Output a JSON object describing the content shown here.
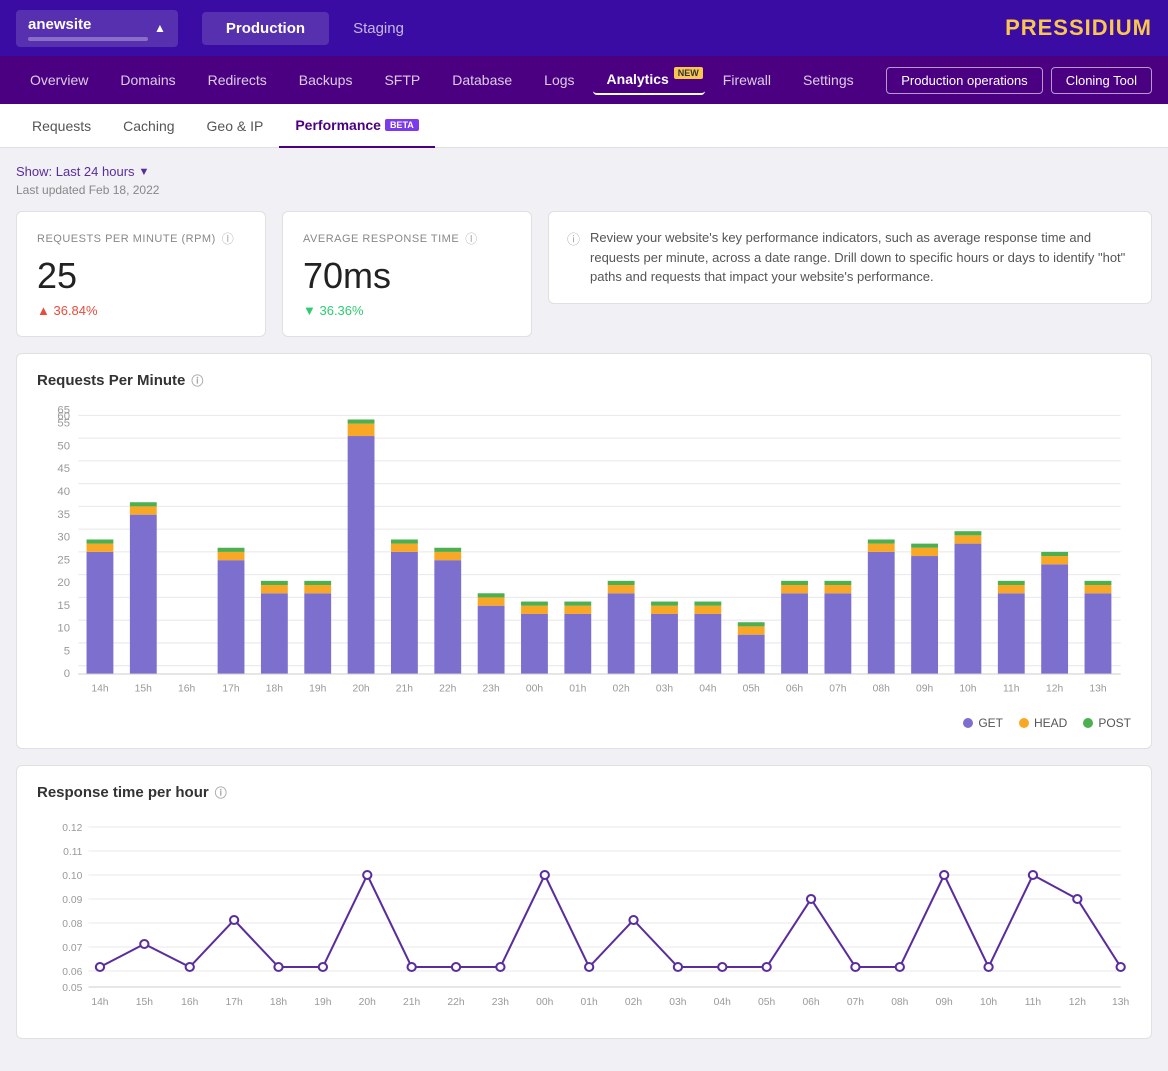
{
  "site": {
    "name": "anewsite",
    "arrow": "▲"
  },
  "env_tabs": [
    {
      "label": "Production",
      "active": true
    },
    {
      "label": "Staging",
      "active": false
    }
  ],
  "logo": {
    "text1": "PRESS",
    "text2": "I",
    "text3": "DIUM"
  },
  "nav": {
    "items": [
      {
        "label": "Overview",
        "active": false,
        "badge": null
      },
      {
        "label": "Domains",
        "active": false,
        "badge": null
      },
      {
        "label": "Redirects",
        "active": false,
        "badge": null
      },
      {
        "label": "Backups",
        "active": false,
        "badge": null
      },
      {
        "label": "SFTP",
        "active": false,
        "badge": null
      },
      {
        "label": "Database",
        "active": false,
        "badge": null
      },
      {
        "label": "Logs",
        "active": false,
        "badge": null
      },
      {
        "label": "Analytics",
        "active": true,
        "badge": "NEW"
      },
      {
        "label": "Firewall",
        "active": false,
        "badge": null
      },
      {
        "label": "Settings",
        "active": false,
        "badge": null
      }
    ],
    "actions": [
      {
        "label": "Production operations"
      },
      {
        "label": "Cloning Tool"
      }
    ]
  },
  "subnav": {
    "items": [
      {
        "label": "Requests",
        "active": false,
        "beta": false
      },
      {
        "label": "Caching",
        "active": false,
        "beta": false
      },
      {
        "label": "Geo & IP",
        "active": false,
        "beta": false
      },
      {
        "label": "Performance",
        "active": true,
        "beta": true
      }
    ]
  },
  "date_filter": {
    "label": "Show: Last 24 hours",
    "last_updated": "Last updated Feb 18, 2022"
  },
  "kpi": {
    "rpm": {
      "label": "REQUESTS PER MINUTE (RPM)",
      "value": "25",
      "change": "▲ 36.84%",
      "change_type": "up"
    },
    "art": {
      "label": "AVERAGE RESPONSE TIME",
      "value": "70ms",
      "change": "▼ 36.36%",
      "change_type": "down"
    },
    "description": "Review your website's key performance indicators, such as average response time and requests per minute, across a date range. Drill down to specific hours or days to identify \"hot\" paths and requests that impact your website's performance."
  },
  "rpm_chart": {
    "title": "Requests Per Minute",
    "labels": [
      "14h",
      "15h",
      "16h",
      "17h",
      "18h",
      "19h",
      "20h",
      "21h",
      "22h",
      "23h",
      "00h",
      "01h",
      "02h",
      "03h",
      "04h",
      "05h",
      "06h",
      "07h",
      "08h",
      "09h",
      "10h",
      "11h",
      "12h",
      "13h"
    ],
    "get_values": [
      30,
      39,
      0,
      28,
      20,
      20,
      59,
      30,
      28,
      17,
      15,
      15,
      20,
      15,
      15,
      10,
      20,
      20,
      30,
      29,
      32,
      20,
      27,
      20
    ],
    "head_values": [
      2,
      2,
      0,
      2,
      1,
      1,
      3,
      1,
      2,
      1,
      1,
      1,
      1,
      1,
      1,
      1,
      1,
      1,
      2,
      2,
      2,
      1,
      2,
      1
    ],
    "post_values": [
      1,
      1,
      0,
      1,
      1,
      1,
      2,
      1,
      1,
      1,
      1,
      1,
      1,
      1,
      1,
      1,
      1,
      1,
      1,
      1,
      1,
      1,
      1,
      1
    ],
    "y_max": 65,
    "y_ticks": [
      0,
      5,
      10,
      15,
      20,
      25,
      30,
      35,
      40,
      45,
      50,
      55,
      60,
      65
    ],
    "legend": {
      "get": "GET",
      "head": "HEAD",
      "post": "POST",
      "get_color": "#7c6fcd",
      "head_color": "#f9a825",
      "post_color": "#4caf50"
    }
  },
  "response_chart": {
    "title": "Response time per hour",
    "labels": [
      "14h",
      "15h",
      "16h",
      "17h",
      "18h",
      "19h",
      "20h",
      "21h",
      "22h",
      "23h",
      "00h",
      "01h",
      "02h",
      "03h",
      "04h",
      "05h",
      "06h",
      "07h",
      "08h",
      "09h",
      "10h",
      "11h",
      "12h",
      "13h"
    ],
    "values": [
      0.06,
      0.07,
      0.06,
      0.08,
      0.06,
      0.06,
      0.1,
      0.06,
      0.06,
      0.06,
      0.1,
      0.06,
      0.08,
      0.06,
      0.06,
      0.06,
      0.09,
      0.06,
      0.06,
      0.1,
      0.06,
      0.1,
      0.09,
      0.06
    ],
    "y_ticks": [
      0.05,
      0.06,
      0.07,
      0.08,
      0.09,
      0.1,
      0.11,
      0.12
    ],
    "y_min": 0.05,
    "y_max": 0.12
  }
}
